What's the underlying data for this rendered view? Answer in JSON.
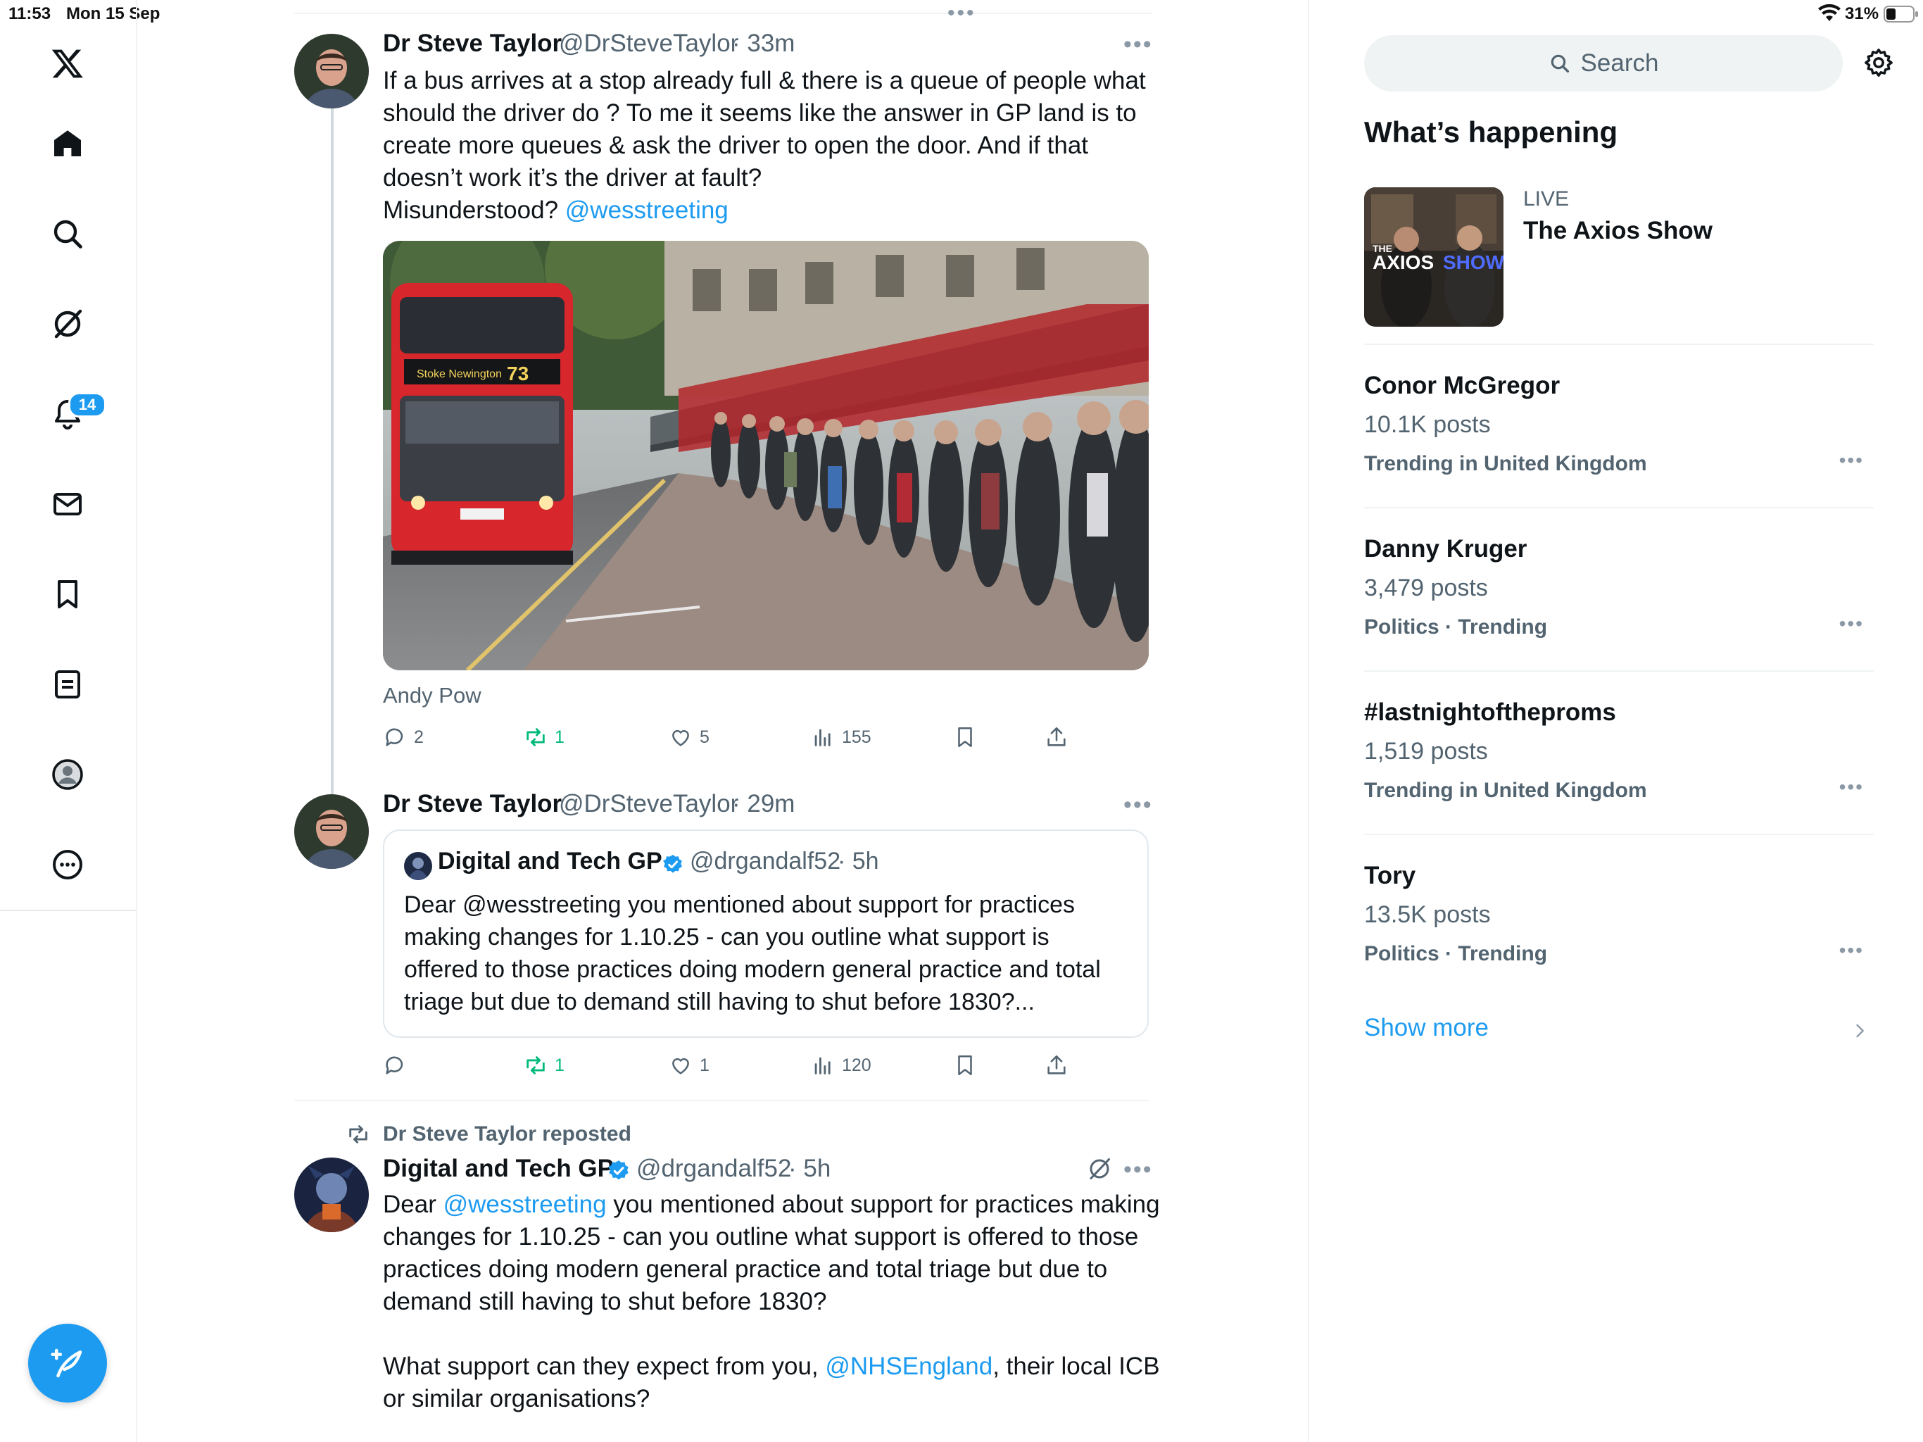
{
  "status_bar": {
    "time": "11:53",
    "date": "Mon 15 Sep",
    "battery": "31%"
  },
  "nav": {
    "notifications_badge": "14"
  },
  "tweets": [
    {
      "name": "Dr Steve Taylor",
      "handle": "@DrSteveTaylor",
      "time": "· 33m",
      "text_lines": [
        "If a bus arrives at a stop already full & there is a queue of people what",
        "should the driver do ? To me it seems like the answer in GP land is to",
        "create more queues & ask the driver to open the door. And if that",
        "doesn’t work it’s the driver at fault?"
      ],
      "last_line_text": "Misunderstood? ",
      "mention": "@wesstreeting",
      "image_caption": "Andy Pow",
      "image_bus_sign": "Stoke Newington",
      "image_bus_number": "73",
      "replies": "2",
      "reposts": "1",
      "likes": "5",
      "views": "155"
    },
    {
      "name": "Dr Steve Taylor",
      "handle": "@DrSteveTaylor",
      "time": "· 29m",
      "quote": {
        "name": "Digital and Tech GP",
        "handle": "@drgandalf52",
        "time": "· 5h",
        "text_lines": [
          "Dear @wesstreeting you mentioned about support for practices",
          "making changes for 1.10.25 - can you outline what support is",
          "offered to those practices doing modern general practice and total",
          "triage but due to demand still having to shut before 1830?..."
        ]
      },
      "replies": "",
      "reposts": "1",
      "likes": "1",
      "views": "120"
    },
    {
      "repost_label": "Dr Steve Taylor reposted",
      "name": "Digital and Tech GP",
      "handle": "@drgandalf52",
      "time": "· 5h",
      "line1_a": "Dear ",
      "line1_mention": "@wesstreeting",
      "line1_b": " you mentioned about support for practices making",
      "lines_mid": [
        "changes for 1.10.25 - can you outline what support is offered to those",
        "practices doing modern general practice and total triage but due to",
        "demand still having to shut before 1830?"
      ],
      "line5_a": "What support can they expect from you, ",
      "line5_mention": "@NHSEngland",
      "line5_b": ", their local ICB",
      "line6": "or similar organisations?"
    }
  ],
  "sidebar": {
    "search_placeholder": "Search",
    "whats_happening": "What’s happening",
    "live": {
      "label": "LIVE",
      "title": "The Axios Show",
      "thumb_text_the": "THE",
      "thumb_text_axios": "AXIOS",
      "thumb_text_show": "SHOW"
    },
    "trends": [
      {
        "title": "Conor McGregor",
        "posts": "10.1K posts",
        "meta": "Trending in United Kingdom"
      },
      {
        "title": "Danny Kruger",
        "posts": "3,479 posts",
        "meta": "Politics · Trending"
      },
      {
        "title": "#lastnightoftheproms",
        "posts": "1,519 posts",
        "meta": "Trending in United Kingdom"
      },
      {
        "title": "Tory",
        "posts": "13.5K posts",
        "meta": "Politics · Trending"
      }
    ],
    "show_more": "Show more"
  },
  "colors": {
    "accent": "#1d9bf0",
    "repost_green": "#00ba7c",
    "muted": "#536471"
  }
}
